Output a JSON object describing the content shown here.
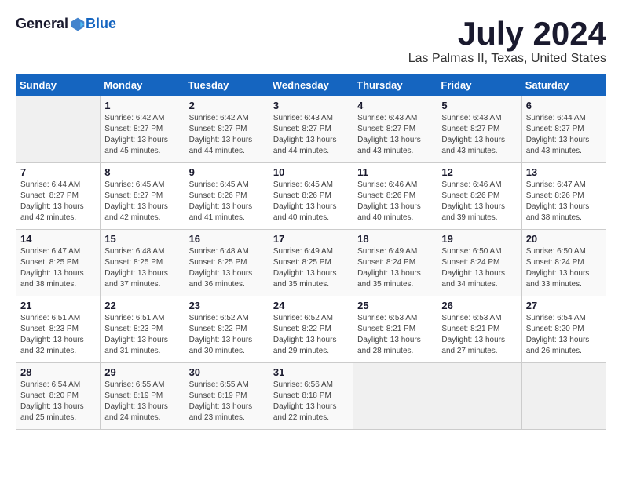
{
  "header": {
    "logo_general": "General",
    "logo_blue": "Blue",
    "title": "July 2024",
    "location": "Las Palmas II, Texas, United States"
  },
  "days_of_week": [
    "Sunday",
    "Monday",
    "Tuesday",
    "Wednesday",
    "Thursday",
    "Friday",
    "Saturday"
  ],
  "weeks": [
    [
      {
        "day": "",
        "empty": true
      },
      {
        "day": "1",
        "sunrise": "6:42 AM",
        "sunset": "8:27 PM",
        "daylight": "13 hours and 45 minutes."
      },
      {
        "day": "2",
        "sunrise": "6:42 AM",
        "sunset": "8:27 PM",
        "daylight": "13 hours and 44 minutes."
      },
      {
        "day": "3",
        "sunrise": "6:43 AM",
        "sunset": "8:27 PM",
        "daylight": "13 hours and 44 minutes."
      },
      {
        "day": "4",
        "sunrise": "6:43 AM",
        "sunset": "8:27 PM",
        "daylight": "13 hours and 43 minutes."
      },
      {
        "day": "5",
        "sunrise": "6:43 AM",
        "sunset": "8:27 PM",
        "daylight": "13 hours and 43 minutes."
      },
      {
        "day": "6",
        "sunrise": "6:44 AM",
        "sunset": "8:27 PM",
        "daylight": "13 hours and 43 minutes."
      }
    ],
    [
      {
        "day": "7",
        "sunrise": "6:44 AM",
        "sunset": "8:27 PM",
        "daylight": "13 hours and 42 minutes."
      },
      {
        "day": "8",
        "sunrise": "6:45 AM",
        "sunset": "8:27 PM",
        "daylight": "13 hours and 42 minutes."
      },
      {
        "day": "9",
        "sunrise": "6:45 AM",
        "sunset": "8:26 PM",
        "daylight": "13 hours and 41 minutes."
      },
      {
        "day": "10",
        "sunrise": "6:45 AM",
        "sunset": "8:26 PM",
        "daylight": "13 hours and 40 minutes."
      },
      {
        "day": "11",
        "sunrise": "6:46 AM",
        "sunset": "8:26 PM",
        "daylight": "13 hours and 40 minutes."
      },
      {
        "day": "12",
        "sunrise": "6:46 AM",
        "sunset": "8:26 PM",
        "daylight": "13 hours and 39 minutes."
      },
      {
        "day": "13",
        "sunrise": "6:47 AM",
        "sunset": "8:26 PM",
        "daylight": "13 hours and 38 minutes."
      }
    ],
    [
      {
        "day": "14",
        "sunrise": "6:47 AM",
        "sunset": "8:25 PM",
        "daylight": "13 hours and 38 minutes."
      },
      {
        "day": "15",
        "sunrise": "6:48 AM",
        "sunset": "8:25 PM",
        "daylight": "13 hours and 37 minutes."
      },
      {
        "day": "16",
        "sunrise": "6:48 AM",
        "sunset": "8:25 PM",
        "daylight": "13 hours and 36 minutes."
      },
      {
        "day": "17",
        "sunrise": "6:49 AM",
        "sunset": "8:25 PM",
        "daylight": "13 hours and 35 minutes."
      },
      {
        "day": "18",
        "sunrise": "6:49 AM",
        "sunset": "8:24 PM",
        "daylight": "13 hours and 35 minutes."
      },
      {
        "day": "19",
        "sunrise": "6:50 AM",
        "sunset": "8:24 PM",
        "daylight": "13 hours and 34 minutes."
      },
      {
        "day": "20",
        "sunrise": "6:50 AM",
        "sunset": "8:24 PM",
        "daylight": "13 hours and 33 minutes."
      }
    ],
    [
      {
        "day": "21",
        "sunrise": "6:51 AM",
        "sunset": "8:23 PM",
        "daylight": "13 hours and 32 minutes."
      },
      {
        "day": "22",
        "sunrise": "6:51 AM",
        "sunset": "8:23 PM",
        "daylight": "13 hours and 31 minutes."
      },
      {
        "day": "23",
        "sunrise": "6:52 AM",
        "sunset": "8:22 PM",
        "daylight": "13 hours and 30 minutes."
      },
      {
        "day": "24",
        "sunrise": "6:52 AM",
        "sunset": "8:22 PM",
        "daylight": "13 hours and 29 minutes."
      },
      {
        "day": "25",
        "sunrise": "6:53 AM",
        "sunset": "8:21 PM",
        "daylight": "13 hours and 28 minutes."
      },
      {
        "day": "26",
        "sunrise": "6:53 AM",
        "sunset": "8:21 PM",
        "daylight": "13 hours and 27 minutes."
      },
      {
        "day": "27",
        "sunrise": "6:54 AM",
        "sunset": "8:20 PM",
        "daylight": "13 hours and 26 minutes."
      }
    ],
    [
      {
        "day": "28",
        "sunrise": "6:54 AM",
        "sunset": "8:20 PM",
        "daylight": "13 hours and 25 minutes."
      },
      {
        "day": "29",
        "sunrise": "6:55 AM",
        "sunset": "8:19 PM",
        "daylight": "13 hours and 24 minutes."
      },
      {
        "day": "30",
        "sunrise": "6:55 AM",
        "sunset": "8:19 PM",
        "daylight": "13 hours and 23 minutes."
      },
      {
        "day": "31",
        "sunrise": "6:56 AM",
        "sunset": "8:18 PM",
        "daylight": "13 hours and 22 minutes."
      },
      {
        "day": "",
        "empty": true
      },
      {
        "day": "",
        "empty": true
      },
      {
        "day": "",
        "empty": true
      }
    ]
  ]
}
